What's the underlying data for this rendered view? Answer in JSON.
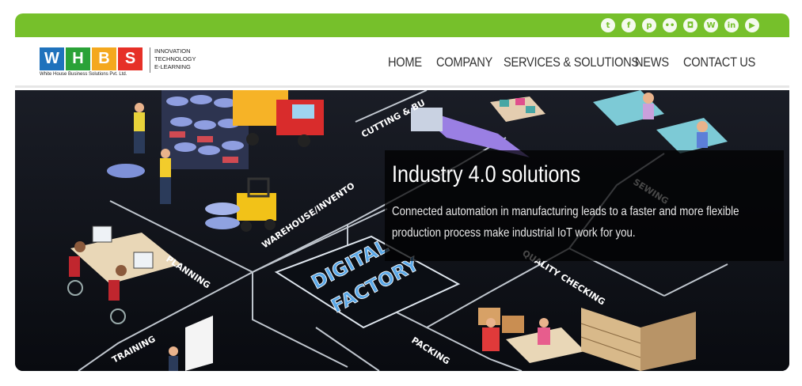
{
  "social": [
    {
      "icon": "twitter-icon",
      "glyph": "t"
    },
    {
      "icon": "facebook-icon",
      "glyph": "f"
    },
    {
      "icon": "pinterest-icon",
      "glyph": "p"
    },
    {
      "icon": "flickr-icon",
      "glyph": "••"
    },
    {
      "icon": "instagram-icon",
      "glyph": "◘"
    },
    {
      "icon": "wordpress-icon",
      "glyph": "W"
    },
    {
      "icon": "linkedin-icon",
      "glyph": "in"
    },
    {
      "icon": "youtube-icon",
      "glyph": "▶"
    }
  ],
  "logo": {
    "letters": [
      "W",
      "H",
      "B",
      "S"
    ],
    "colors": [
      "#1f72bc",
      "#2aa238",
      "#f4a81e",
      "#e63027"
    ],
    "company_name": "White House Business Solutions Pvt. Ltd.",
    "tagline": [
      "INNOVATION",
      "TECHNOLOGY",
      "E-LEARNING"
    ]
  },
  "nav": {
    "items": [
      "HOME",
      "COMPANY",
      "SERVICES & SOLUTIONS",
      "NEWS",
      "CONTACT US"
    ]
  },
  "hero": {
    "title": "Industry 4.0 solutions",
    "text": "Connected automation in manufacturing leads to a faster and more flexible production process make industrial IoT work for you.",
    "center_label": [
      "DIGITAL",
      "FACTORY"
    ],
    "zone_labels": [
      "CUTTING & BU",
      "WAREHOUSE/INVENTO",
      "PLANNING",
      "SEWING",
      "QUALITY CHECKING",
      "PACKING",
      "TRAINING"
    ]
  },
  "colors": {
    "topbar": "#76c02b",
    "accent_blue": "#1f72bc",
    "hero_bg": "#0e1118"
  }
}
